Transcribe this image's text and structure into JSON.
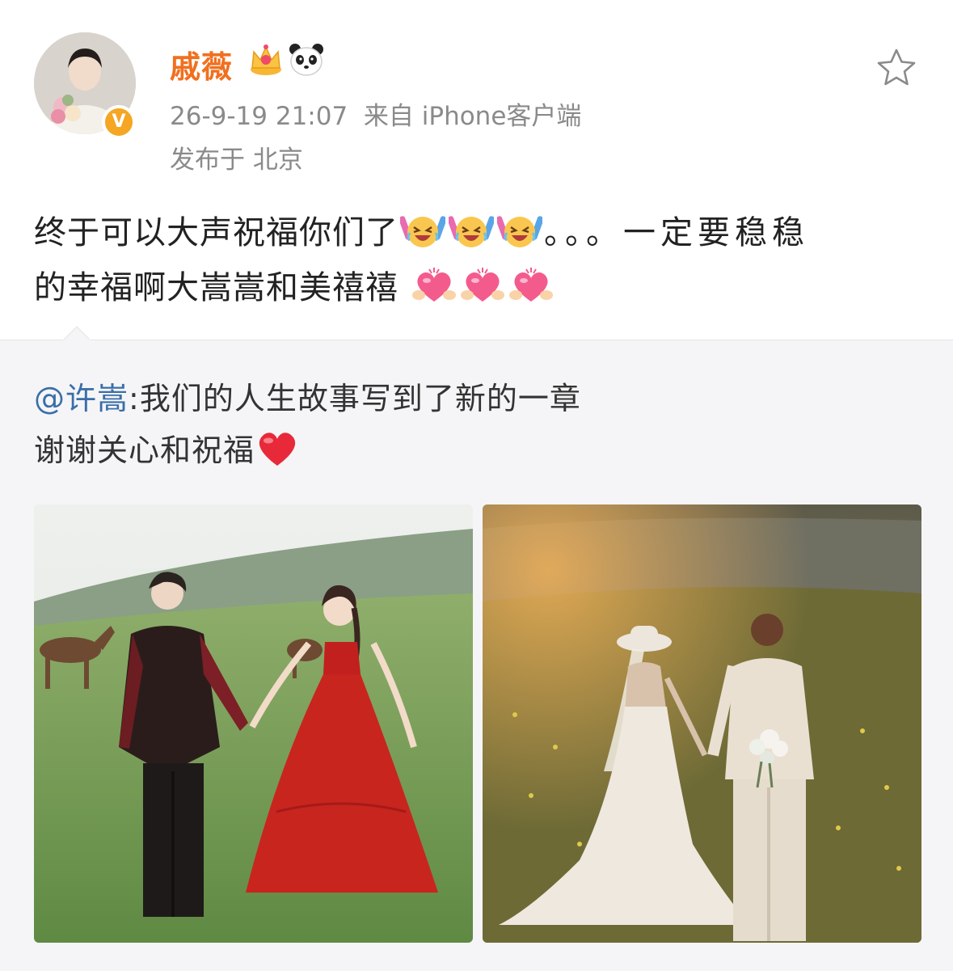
{
  "post": {
    "author": {
      "name": "戚薇",
      "verified_mark": "V",
      "badge_icons": [
        "crown-icon",
        "panda-icon"
      ],
      "avatar_icon": "avatar"
    },
    "timestamp": "26-9-19 21:07",
    "source": "来自 iPhone客户端",
    "location": "发布于 北京",
    "text_line1_a": "终于可以大声祝福你们了",
    "text_line1_b": "。。。一定要稳稳",
    "text_line2": "的幸福啊大嵩嵩和美禧禧",
    "emojis": [
      "laughing-cry-emoji",
      "laughing-cry-emoji",
      "laughing-cry-emoji",
      "heart-hands-emoji",
      "heart-hands-emoji",
      "heart-hands-emoji"
    ]
  },
  "repost": {
    "mention": "@许嵩",
    "text_line1": ":我们的人生故事写到了新的一章",
    "text_line2": "谢谢关心和祝福",
    "emoji": "red-heart-emoji",
    "photos": [
      "couple-meadow-photo",
      "couple-sunset-photo"
    ]
  },
  "colors": {
    "username": "#f0701f",
    "mention": "#3a6ea8",
    "meta": "#8a8a8a",
    "repost_bg": "#f5f5f7"
  }
}
